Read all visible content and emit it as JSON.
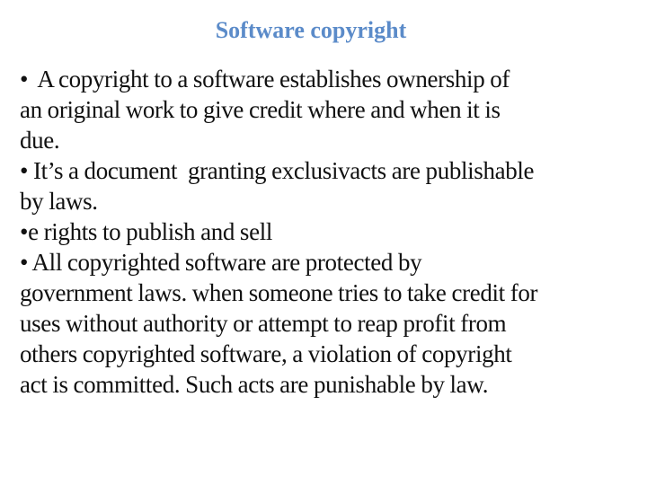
{
  "slide": {
    "title": "Software copyright",
    "title_color": "#5b8bc9",
    "text_color": "#111111",
    "body_lines": [
      "•  A copyright to a software establishes ownership of",
      "an original work to give credit where and when it is",
      "due.",
      "• It’s a document  granting exclusivacts are publishable",
      "by laws.",
      "•e rights to publish and sell",
      "• All copyrighted software are protected by",
      "government laws. when someone tries to take credit for",
      "uses without authority or attempt to reap profit from",
      "others copyrighted software, a violation of copyright",
      "act is committed. Such acts are punishable by law."
    ]
  }
}
